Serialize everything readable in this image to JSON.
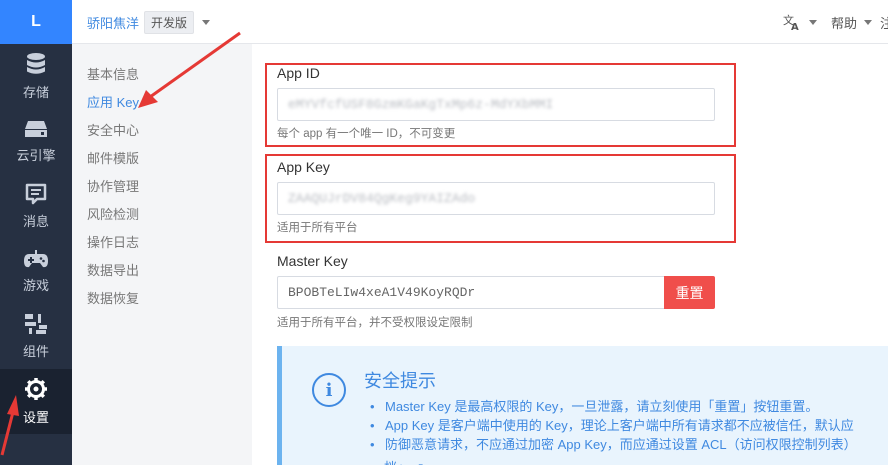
{
  "sidebar": {
    "logo": "L",
    "items": [
      {
        "label": "存储",
        "icon": "database-icon"
      },
      {
        "label": "云引擎",
        "icon": "cloud-engine-icon"
      },
      {
        "label": "消息",
        "icon": "message-icon"
      },
      {
        "label": "游戏",
        "icon": "gamepad-icon"
      },
      {
        "label": "组件",
        "icon": "components-icon"
      },
      {
        "label": "设置",
        "icon": "gear-icon",
        "active": true
      }
    ]
  },
  "topbar": {
    "app_name": "骄阳焦洋",
    "plan_badge": "开发版",
    "language_icon": "translate-icon",
    "help_label": "帮助",
    "more_label": "注"
  },
  "submenu": {
    "items": [
      {
        "label": "基本信息",
        "active": false
      },
      {
        "label": "应用 Key",
        "active": true
      },
      {
        "label": "安全中心",
        "active": false
      },
      {
        "label": "邮件模版",
        "active": false
      },
      {
        "label": "协作管理",
        "active": false
      },
      {
        "label": "风险检测",
        "active": false
      },
      {
        "label": "操作日志",
        "active": false
      },
      {
        "label": "数据导出",
        "active": false
      },
      {
        "label": "数据恢复",
        "active": false
      }
    ]
  },
  "app_id": {
    "label": "App ID",
    "value": "eMYVfcfUSF8GzmKGaKgTxMp6z-MdYXbMMI",
    "help": "每个 app 有一个唯一 ID，不可变更"
  },
  "app_key": {
    "label": "App Key",
    "value": "ZAAQUJrDV84QgKeg9YAIZAdo",
    "help": "适用于所有平台"
  },
  "master_key": {
    "label": "Master Key",
    "value": "BPOBTeLIw4xeA1V49KoyRQDr",
    "reset_label": "重置",
    "help": "适用于所有平台，并不受权限设定限制"
  },
  "security_notice": {
    "icon": "info-icon",
    "title": "安全提示",
    "items": [
      "Master Key 是最高权限的 Key，一旦泄露，请立刻使用「重置」按钮重置。",
      "App Key 是客户端中使用的 Key，理论上客户端中所有请求都不应被信任，默认应",
      "防御恶意请求，不应通过加密 App Key，而应通过设置 ACL（访问权限控制列表）"
    ],
    "continuation": "档」"
  },
  "colors": {
    "accent": "#3f89e0",
    "sidebar_bg": "#263042",
    "logo_bg": "#3385ff",
    "danger": "#f04e4b",
    "annotation": "#e53935"
  }
}
